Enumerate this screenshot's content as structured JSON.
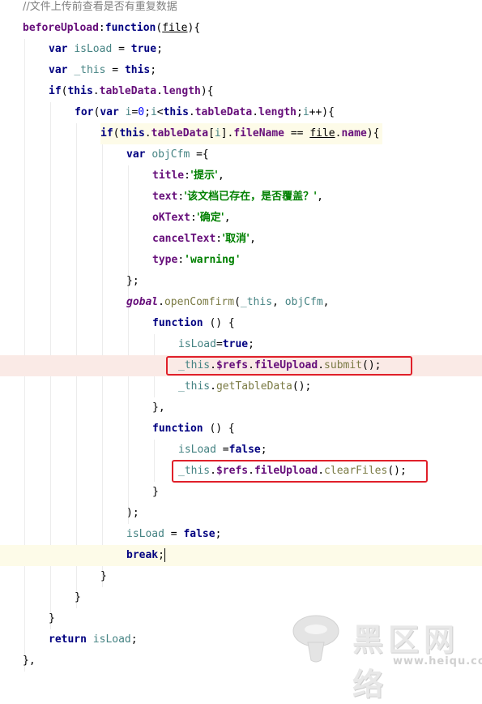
{
  "editor": {
    "lines": [
      {
        "indent": 0,
        "tokens": [
          {
            "t": "//文件上传前查看是否有重复数据",
            "c": "tok-comment tok-cjk"
          }
        ]
      },
      {
        "indent": 0,
        "tokens": [
          {
            "t": "beforeUpload",
            "c": "tok-prop"
          },
          {
            "t": ":",
            "c": "tok-punc"
          },
          {
            "t": "function",
            "c": "tok-kw"
          },
          {
            "t": "(",
            "c": "tok-punc"
          },
          {
            "t": "file",
            "c": "tok-param"
          },
          {
            "t": "){",
            "c": "tok-punc"
          }
        ]
      },
      {
        "indent": 1,
        "tokens": [
          {
            "t": "var ",
            "c": "tok-kw"
          },
          {
            "t": "isLoad",
            "c": "tok-var"
          },
          {
            "t": " = ",
            "c": "tok-punc"
          },
          {
            "t": "true",
            "c": "tok-kw"
          },
          {
            "t": ";",
            "c": "tok-punc"
          }
        ]
      },
      {
        "indent": 1,
        "tokens": [
          {
            "t": "var ",
            "c": "tok-kw"
          },
          {
            "t": "_this",
            "c": "tok-var"
          },
          {
            "t": " = ",
            "c": "tok-punc"
          },
          {
            "t": "this",
            "c": "tok-kw"
          },
          {
            "t": ";",
            "c": "tok-punc"
          }
        ]
      },
      {
        "indent": 1,
        "tokens": [
          {
            "t": "if",
            "c": "tok-kw"
          },
          {
            "t": "(",
            "c": "tok-punc"
          },
          {
            "t": "this",
            "c": "tok-kw"
          },
          {
            "t": ".",
            "c": "tok-punc"
          },
          {
            "t": "tableData",
            "c": "tok-prop"
          },
          {
            "t": ".",
            "c": "tok-punc"
          },
          {
            "t": "length",
            "c": "tok-prop"
          },
          {
            "t": "){",
            "c": "tok-punc"
          }
        ]
      },
      {
        "indent": 2,
        "tokens": [
          {
            "t": "for",
            "c": "tok-kw"
          },
          {
            "t": "(",
            "c": "tok-punc"
          },
          {
            "t": "var ",
            "c": "tok-kw"
          },
          {
            "t": "i",
            "c": "tok-var"
          },
          {
            "t": "=",
            "c": "tok-punc"
          },
          {
            "t": "0",
            "c": "tok-num"
          },
          {
            "t": ";",
            "c": "tok-punc"
          },
          {
            "t": "i",
            "c": "tok-var"
          },
          {
            "t": "<",
            "c": "tok-punc"
          },
          {
            "t": "this",
            "c": "tok-kw"
          },
          {
            "t": ".",
            "c": "tok-punc"
          },
          {
            "t": "tableData",
            "c": "tok-prop"
          },
          {
            "t": ".",
            "c": "tok-punc"
          },
          {
            "t": "length",
            "c": "tok-prop"
          },
          {
            "t": ";",
            "c": "tok-punc"
          },
          {
            "t": "i",
            "c": "tok-var"
          },
          {
            "t": "++){",
            "c": "tok-punc"
          }
        ]
      },
      {
        "indent": 3,
        "cond": true,
        "tokens": [
          {
            "t": "if",
            "c": "tok-kw"
          },
          {
            "t": "(",
            "c": "tok-punc"
          },
          {
            "t": "this",
            "c": "tok-kw"
          },
          {
            "t": ".",
            "c": "tok-punc"
          },
          {
            "t": "tableData",
            "c": "tok-prop"
          },
          {
            "t": "[",
            "c": "tok-punc"
          },
          {
            "t": "i",
            "c": "tok-var"
          },
          {
            "t": "].",
            "c": "tok-punc"
          },
          {
            "t": "fileName",
            "c": "tok-prop"
          },
          {
            "t": " == ",
            "c": "tok-punc"
          },
          {
            "t": "file",
            "c": "tok-param"
          },
          {
            "t": ".",
            "c": "tok-punc"
          },
          {
            "t": "name",
            "c": "tok-prop"
          },
          {
            "t": "){",
            "c": "tok-punc"
          }
        ]
      },
      {
        "indent": 4,
        "tokens": [
          {
            "t": "var ",
            "c": "tok-kw"
          },
          {
            "t": "objCfm",
            "c": "tok-var"
          },
          {
            "t": " ={",
            "c": "tok-punc"
          }
        ]
      },
      {
        "indent": 5,
        "tokens": [
          {
            "t": "title",
            "c": "tok-prop"
          },
          {
            "t": ":",
            "c": "tok-punc"
          },
          {
            "t": "'提示'",
            "c": "tok-str tok-cjk"
          },
          {
            "t": ",",
            "c": "tok-punc"
          }
        ]
      },
      {
        "indent": 5,
        "tokens": [
          {
            "t": "text",
            "c": "tok-prop"
          },
          {
            "t": ":",
            "c": "tok-punc"
          },
          {
            "t": "'该文档已存在，是否覆盖？'",
            "c": "tok-str tok-cjk"
          },
          {
            "t": ",",
            "c": "tok-punc"
          }
        ]
      },
      {
        "indent": 5,
        "tokens": [
          {
            "t": "oKText",
            "c": "tok-prop"
          },
          {
            "t": ":",
            "c": "tok-punc"
          },
          {
            "t": "'确定'",
            "c": "tok-str tok-cjk"
          },
          {
            "t": ",",
            "c": "tok-punc"
          }
        ]
      },
      {
        "indent": 5,
        "tokens": [
          {
            "t": "cancelText",
            "c": "tok-prop"
          },
          {
            "t": ":",
            "c": "tok-punc"
          },
          {
            "t": "'取消'",
            "c": "tok-str tok-cjk"
          },
          {
            "t": ",",
            "c": "tok-punc"
          }
        ]
      },
      {
        "indent": 5,
        "tokens": [
          {
            "t": "type",
            "c": "tok-prop"
          },
          {
            "t": ":",
            "c": "tok-punc"
          },
          {
            "t": "'warning'",
            "c": "tok-str"
          }
        ]
      },
      {
        "indent": 4,
        "tokens": [
          {
            "t": "};",
            "c": "tok-punc"
          }
        ]
      },
      {
        "indent": 4,
        "tokens": [
          {
            "t": "gobal",
            "c": "tok-global"
          },
          {
            "t": ".",
            "c": "tok-punc"
          },
          {
            "t": "openComfirm",
            "c": "tok-method"
          },
          {
            "t": "(",
            "c": "tok-punc"
          },
          {
            "t": "_this",
            "c": "tok-var"
          },
          {
            "t": ", ",
            "c": "tok-punc"
          },
          {
            "t": "objCfm",
            "c": "tok-var"
          },
          {
            "t": ",",
            "c": "tok-punc"
          }
        ]
      },
      {
        "indent": 5,
        "tokens": [
          {
            "t": "function",
            "c": "tok-kw"
          },
          {
            "t": " () {",
            "c": "tok-punc"
          }
        ]
      },
      {
        "indent": 6,
        "tokens": [
          {
            "t": "isLoad",
            "c": "tok-var"
          },
          {
            "t": "=",
            "c": "tok-punc"
          },
          {
            "t": "true",
            "c": "tok-kw"
          },
          {
            "t": ";",
            "c": "tok-punc"
          }
        ]
      },
      {
        "indent": 6,
        "hl": "hl-error",
        "tokens": [
          {
            "t": "_this",
            "c": "tok-var"
          },
          {
            "t": ".",
            "c": "tok-punc"
          },
          {
            "t": "$refs",
            "c": "tok-prop"
          },
          {
            "t": ".",
            "c": "tok-punc"
          },
          {
            "t": "fileUpload",
            "c": "tok-prop"
          },
          {
            "t": ".",
            "c": "tok-punc"
          },
          {
            "t": "submit",
            "c": "tok-method"
          },
          {
            "t": "();",
            "c": "tok-punc"
          }
        ]
      },
      {
        "indent": 6,
        "tokens": [
          {
            "t": "_this",
            "c": "tok-var"
          },
          {
            "t": ".",
            "c": "tok-punc"
          },
          {
            "t": "getTableData",
            "c": "tok-method"
          },
          {
            "t": "();",
            "c": "tok-punc"
          }
        ]
      },
      {
        "indent": 5,
        "tokens": [
          {
            "t": "},",
            "c": "tok-punc"
          }
        ]
      },
      {
        "indent": 5,
        "tokens": [
          {
            "t": "function",
            "c": "tok-kw"
          },
          {
            "t": " () {",
            "c": "tok-punc"
          }
        ]
      },
      {
        "indent": 6,
        "tokens": [
          {
            "t": "isLoad",
            "c": "tok-var"
          },
          {
            "t": " =",
            "c": "tok-punc"
          },
          {
            "t": "false",
            "c": "tok-kw"
          },
          {
            "t": ";",
            "c": "tok-punc"
          }
        ]
      },
      {
        "indent": 6,
        "tokens": [
          {
            "t": "_this",
            "c": "tok-var"
          },
          {
            "t": ".",
            "c": "tok-punc"
          },
          {
            "t": "$refs",
            "c": "tok-prop"
          },
          {
            "t": ".",
            "c": "tok-punc"
          },
          {
            "t": "fileUpload",
            "c": "tok-prop"
          },
          {
            "t": ".",
            "c": "tok-punc"
          },
          {
            "t": "clearFiles",
            "c": "tok-method"
          },
          {
            "t": "();",
            "c": "tok-punc"
          }
        ]
      },
      {
        "indent": 5,
        "tokens": [
          {
            "t": "}",
            "c": "tok-punc"
          }
        ]
      },
      {
        "indent": 4,
        "tokens": [
          {
            "t": ");",
            "c": "tok-punc"
          }
        ]
      },
      {
        "indent": 4,
        "tokens": [
          {
            "t": "isLoad",
            "c": "tok-var"
          },
          {
            "t": " = ",
            "c": "tok-punc"
          },
          {
            "t": "false",
            "c": "tok-kw"
          },
          {
            "t": ";",
            "c": "tok-punc"
          }
        ]
      },
      {
        "indent": 4,
        "hl": "hl-current",
        "caret": true,
        "tokens": [
          {
            "t": "break",
            "c": "tok-kw"
          },
          {
            "t": ";",
            "c": "tok-punc"
          }
        ]
      },
      {
        "indent": 3,
        "tokens": [
          {
            "t": "}",
            "c": "tok-punc"
          }
        ]
      },
      {
        "indent": 2,
        "tokens": [
          {
            "t": "}",
            "c": "tok-punc"
          }
        ]
      },
      {
        "indent": 1,
        "tokens": [
          {
            "t": "}",
            "c": "tok-punc"
          }
        ]
      },
      {
        "indent": 1,
        "tokens": [
          {
            "t": "return ",
            "c": "tok-kw"
          },
          {
            "t": "isLoad",
            "c": "tok-var"
          },
          {
            "t": ";",
            "c": "tok-punc"
          }
        ]
      },
      {
        "indent": 0,
        "tokens": [
          {
            "t": "},",
            "c": "tok-punc"
          }
        ]
      }
    ]
  },
  "colors": {
    "keyword": "#000080",
    "property": "#660e7a",
    "variable": "#458383",
    "string": "#008000",
    "comment": "#808080",
    "highlight_box": "#e0202a"
  },
  "watermark": {
    "text": "黑区网络",
    "url": "www.heiqu.com"
  }
}
